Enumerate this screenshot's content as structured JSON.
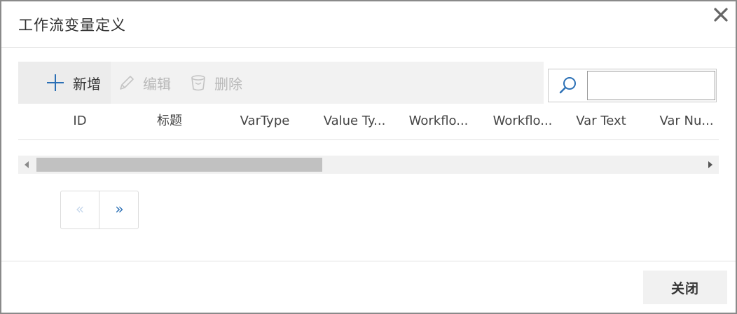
{
  "dialog": {
    "title": "工作流变量定义",
    "close_icon": "close-icon"
  },
  "toolbar": {
    "add_label": "新增",
    "edit_label": "编辑",
    "delete_label": "删除",
    "add_icon": "plus-icon",
    "edit_icon": "pencil-icon",
    "delete_icon": "trash-icon"
  },
  "search": {
    "icon": "search-icon",
    "value": "",
    "placeholder": ""
  },
  "grid": {
    "columns": [
      "ID",
      "标题",
      "VarType",
      "Value Ty...",
      "Workflo...",
      "Workflo...",
      "Var Text",
      "Var Nu..."
    ]
  },
  "scrollbar": {
    "left_arrow": "left-arrow-icon",
    "right_arrow": "right-arrow-icon"
  },
  "pager": {
    "prev_label": "«",
    "next_label": "»"
  },
  "footer": {
    "close_label": "关闭"
  },
  "colors": {
    "accent": "#2a6fb5",
    "disabled_text": "#b8b8b8",
    "toolbar_bg": "#f2f2f2"
  }
}
